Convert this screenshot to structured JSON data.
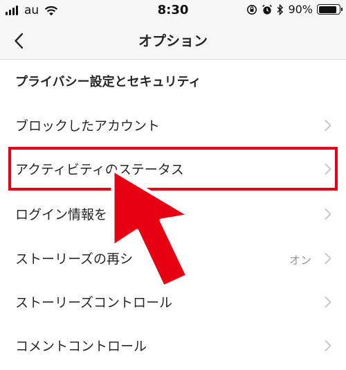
{
  "status_bar": {
    "carrier": "au",
    "time": "8:30",
    "battery": "90%",
    "battery_level": 0.9
  },
  "nav": {
    "title": "オプション",
    "back_icon": "chevron-left-icon"
  },
  "section": {
    "title": "プライバシー設定とセキュリティ"
  },
  "rows": [
    {
      "label": "ブロックしたアカウント",
      "value": ""
    },
    {
      "label": "アクティビティのステータス",
      "value": ""
    },
    {
      "label": "ログイン情報を",
      "value": ""
    },
    {
      "label": "ストーリーズの再シ",
      "value": "オン"
    },
    {
      "label": "ストーリーズコントロール",
      "value": ""
    },
    {
      "label": "コメントコントロール",
      "value": ""
    }
  ],
  "colors": {
    "annotation": "#e60012",
    "chevron": "#c7c7cc",
    "value_text": "#999999"
  }
}
